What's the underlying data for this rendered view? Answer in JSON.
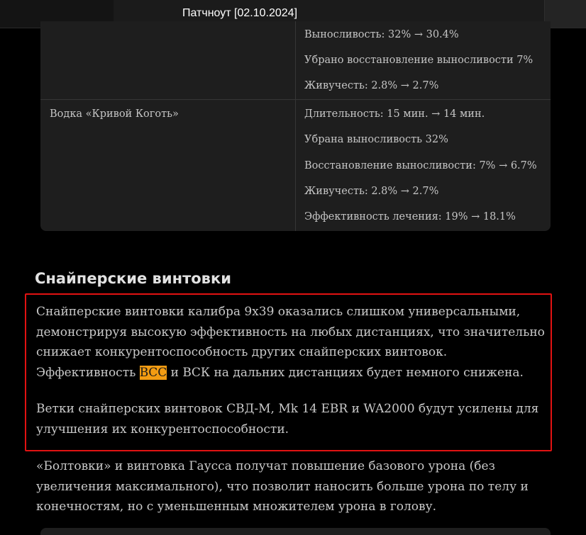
{
  "window": {
    "title": "Патчноут [02.10.2024]"
  },
  "table": {
    "rows": [
      {
        "name": "",
        "effects": [
          "Выносливость: 32% → 30.4%",
          "Убрано восстановление выносливости 7%",
          "Живучесть: 2.8% → 2.7%"
        ]
      },
      {
        "name": "Водка «Кривой Коготь»",
        "effects": [
          "Длительность: 15 мин. → 14 мин.",
          "Убрана выносливость 32%",
          "Восстановление выносливости: 7% → 6.7%",
          "Живучесть: 2.8% → 2.7%",
          "Эффективность лечения: 19% → 18.1%"
        ]
      }
    ]
  },
  "section": {
    "heading": "Снайперские винтовки",
    "para1": {
      "line1": "Снайперские винтовки калибра 9x39 оказались слишком универсальными,",
      "line2": "демонстрируя высокую эффективность на любых дистанциях, что значительно",
      "line3": "снижает конкурентоспособность других снайперских винтовок.",
      "line4_pre": "Эффективность ",
      "line4_mark": "ВСС",
      "line4_post": " и ВСК на дальних дистанциях будет немного снижена."
    },
    "para2": {
      "line1": "Ветки снайперских винтовок СВД-М, Mk 14 EBR и WA2000 будут усилены для",
      "line2": "улучшения их конкурентоспособности."
    },
    "para3": {
      "line1": "«Болтовки» и винтовка Гаусса получат повышение базового урона (без",
      "line2": "увеличения максимального), что позволит наносить больше урона по телу и",
      "line3": "конечностям, но с уменьшенным множителем урона в голову."
    }
  },
  "colors": {
    "highlight_border": "#e11212",
    "search_mark": "#f39c12"
  }
}
